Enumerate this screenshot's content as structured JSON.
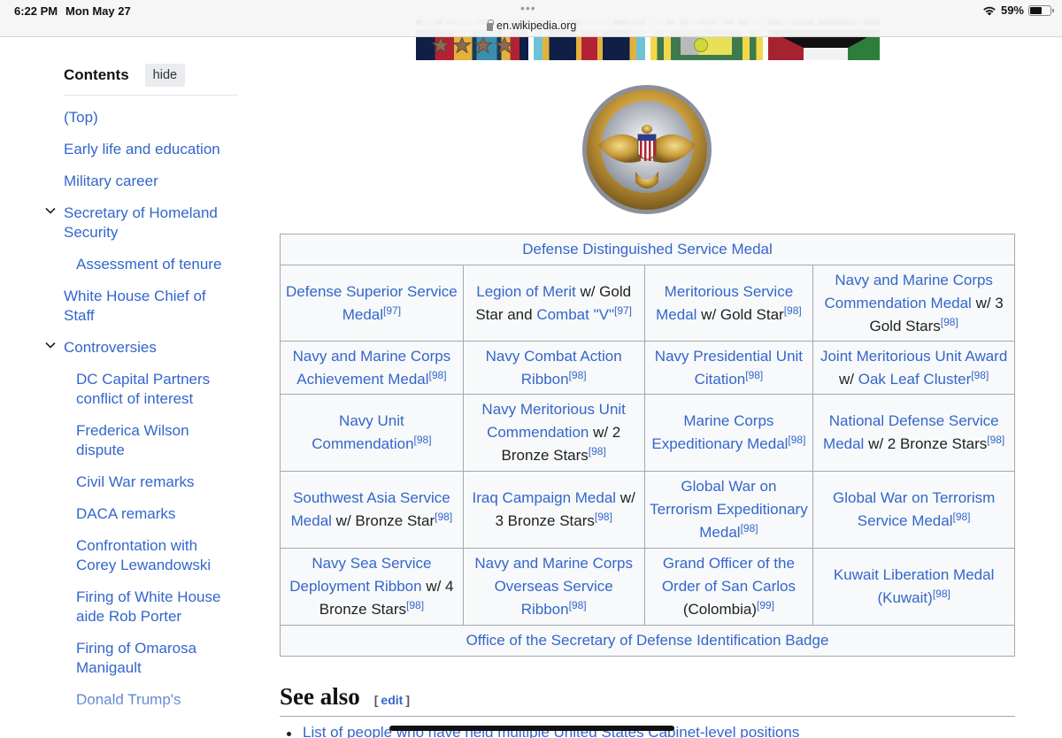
{
  "status_bar": {
    "time": "6:22 PM",
    "date": "Mon May 27",
    "dots": "•••",
    "url": "en.wikipedia.org",
    "battery_percent": "59%",
    "battery_level": 0.59,
    "icons": [
      "lock-icon",
      "wifi-icon",
      "battery-icon"
    ]
  },
  "toc": {
    "title": "Contents",
    "hide_label": "hide",
    "items": [
      {
        "label": "(Top)",
        "level": 1,
        "expanded": null
      },
      {
        "label": "Early life and education",
        "level": 1,
        "expanded": null
      },
      {
        "label": "Military career",
        "level": 1,
        "expanded": null
      },
      {
        "label": "Secretary of Homeland Security",
        "level": 1,
        "expanded": true
      },
      {
        "label": "Assessment of tenure",
        "level": 2,
        "expanded": null
      },
      {
        "label": "White House Chief of Staff",
        "level": 1,
        "expanded": null
      },
      {
        "label": "Controversies",
        "level": 1,
        "expanded": true
      },
      {
        "label": "DC Capital Partners conflict of interest",
        "level": 2,
        "expanded": null
      },
      {
        "label": "Frederica Wilson dispute",
        "level": 2,
        "expanded": null
      },
      {
        "label": "Civil War remarks",
        "level": 2,
        "expanded": null
      },
      {
        "label": "DACA remarks",
        "level": 2,
        "expanded": null
      },
      {
        "label": "Confrontation with Corey Lewandowski",
        "level": 2,
        "expanded": null
      },
      {
        "label": "Firing of White House aide Rob Porter",
        "level": 2,
        "expanded": null
      },
      {
        "label": "Firing of Omarosa Manigault",
        "level": 2,
        "expanded": null
      },
      {
        "label": "Donald Trump's",
        "level": 2,
        "expanded": null
      }
    ]
  },
  "images": {
    "ribbon_rack_alt": "Award ribbon rack",
    "badge_alt": "Office of the Secretary of Defense Identification Badge"
  },
  "awards_table": {
    "top_row": {
      "link": "Defense Distinguished Service Medal"
    },
    "rows": [
      [
        {
          "link": "Defense Superior Service Medal",
          "plain": "",
          "ref": "[97]"
        },
        {
          "link": "Legion of Merit",
          "plain": " w/ Gold Star and ",
          "link2": "Combat \"V\"",
          "ref": "[97]"
        },
        {
          "link": "Meritorious Service Medal",
          "plain": " w/ Gold Star",
          "ref": "[98]"
        },
        {
          "link": "Navy and Marine Corps Commendation Medal",
          "plain": " w/ 3 Gold Stars",
          "ref": "[98]"
        }
      ],
      [
        {
          "link": "Navy and Marine Corps Achievement Medal",
          "plain": "",
          "ref": "[98]"
        },
        {
          "link": "Navy Combat Action Ribbon",
          "plain": "",
          "ref": "[98]"
        },
        {
          "link": "Navy Presidential Unit Citation",
          "plain": "",
          "ref": "[98]"
        },
        {
          "link": "Joint Meritorious Unit Award",
          "plain": " w/ ",
          "link2": "Oak Leaf Cluster",
          "ref": "[98]"
        }
      ],
      [
        {
          "link": "Navy Unit Commendation",
          "plain": "",
          "ref": "[98]"
        },
        {
          "link": "Navy Meritorious Unit Commendation",
          "plain": " w/ 2 Bronze Stars",
          "ref": "[98]"
        },
        {
          "link": "Marine Corps Expeditionary Medal",
          "plain": "",
          "ref": "[98]"
        },
        {
          "link": "National Defense Service Medal",
          "plain": " w/ 2 Bronze Stars",
          "ref": "[98]"
        }
      ],
      [
        {
          "link": "Southwest Asia Service Medal",
          "plain": " w/ Bronze Star",
          "ref": "[98]"
        },
        {
          "link": "Iraq Campaign Medal",
          "plain": " w/ 3 Bronze Stars",
          "ref": "[98]"
        },
        {
          "link": "Global War on Terrorism Expeditionary Medal",
          "plain": "",
          "ref": "[98]"
        },
        {
          "link": "Global War on Terrorism Service Medal",
          "plain": "",
          "ref": "[98]"
        }
      ],
      [
        {
          "link": "Navy Sea Service Deployment Ribbon",
          "plain": " w/ 4 Bronze Stars",
          "ref": "[98]"
        },
        {
          "link": "Navy and Marine Corps Overseas Service Ribbon",
          "plain": "",
          "ref": "[98]"
        },
        {
          "link": "Grand Officer of the Order of San Carlos",
          "plain": " (Colombia)",
          "ref": "[99]"
        },
        {
          "link": "Kuwait Liberation Medal (Kuwait)",
          "plain": "",
          "ref": "[98]"
        }
      ]
    ],
    "bottom_row": {
      "link": "Office of the Secretary of Defense Identification Badge"
    }
  },
  "see_also": {
    "heading": "See also",
    "edit_open": "[",
    "edit_label": "edit",
    "edit_close": "]",
    "items": [
      "List of people who have held multiple United States Cabinet-level positions"
    ]
  },
  "colors": {
    "link": "#3366cc",
    "table_bg": "#f8f9fa",
    "table_border": "#a2a9b1",
    "hide_button_bg": "#eaecf0"
  }
}
